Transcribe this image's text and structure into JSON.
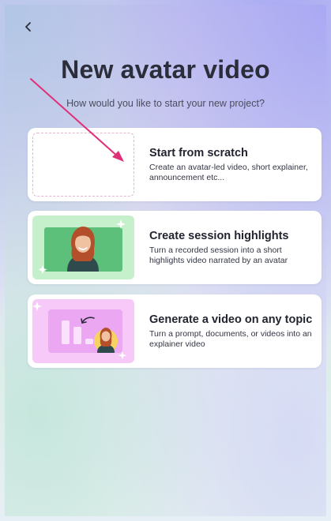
{
  "header": {
    "back_icon": "chevron-left-icon",
    "title": "New avatar video",
    "subtitle": "How would you like to start your new project?"
  },
  "options": [
    {
      "heading": "Start from scratch",
      "description": "Create an avatar-led video, short explainer, announcement etc..."
    },
    {
      "heading": "Create session highlights",
      "description": "Turn a recorded session into a short highlights video narrated by an avatar"
    },
    {
      "heading": "Generate a video on any topic",
      "description": "Turn a prompt, documents, or videos into an explainer video"
    }
  ],
  "colors": {
    "arrow": "#e0307a",
    "text_dark": "#2b2d3a",
    "highlights_bg": "#c6efcc",
    "highlights_inner": "#5cc07a",
    "topic_bg": "#f6c9f9",
    "topic_inner": "#eba7f2"
  }
}
